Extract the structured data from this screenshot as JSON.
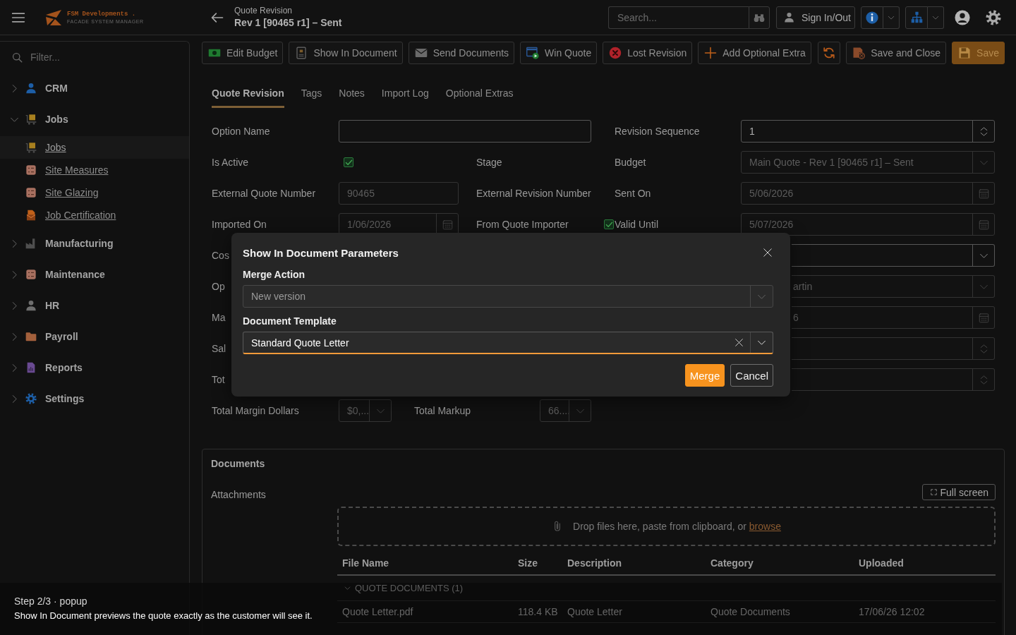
{
  "app_bar": {
    "brand": "FSM Developments .",
    "tagline": "FACADE SYSTEM MANAGER",
    "page_kicker": "Quote Revision",
    "page_title": "Rev 1 [90465 r1] – Sent",
    "search": {
      "placeholder": "Search..."
    },
    "sign_in_button": "Sign In/Out"
  },
  "sidebar": {
    "filter": {
      "placeholder": "Filter..."
    },
    "items": [
      {
        "label": "CRM",
        "expanded": false
      },
      {
        "label": "Jobs",
        "expanded": true,
        "children": [
          {
            "label": "Jobs",
            "selected": true
          },
          {
            "label": "Site Measures",
            "selected": false
          },
          {
            "label": "Site Glazing",
            "selected": false
          },
          {
            "label": "Job Certification",
            "selected": false
          }
        ]
      },
      {
        "label": "Manufacturing",
        "expanded": false
      },
      {
        "label": "Maintenance",
        "expanded": false
      },
      {
        "label": "HR",
        "expanded": false
      },
      {
        "label": "Payroll",
        "expanded": false
      },
      {
        "label": "Reports",
        "expanded": false
      },
      {
        "label": "Settings",
        "expanded": false
      }
    ]
  },
  "toolbar": {
    "buttons": [
      {
        "label": "Edit Budget"
      },
      {
        "label": "Show In Document"
      },
      {
        "label": "Send Documents"
      },
      {
        "label": "Win Quote"
      },
      {
        "label": "Lost Revision"
      },
      {
        "label": "Add Optional Extra"
      }
    ],
    "actions": [
      {
        "label": "Save and Close",
        "kind": "secondary",
        "disabled": false
      },
      {
        "label": "Save",
        "kind": "primary",
        "disabled": true
      }
    ]
  },
  "tabs": [
    {
      "label": "Quote Revision",
      "selected": true
    },
    {
      "label": "Tags",
      "selected": false
    },
    {
      "label": "Notes",
      "selected": false
    },
    {
      "label": "Import Log",
      "selected": false
    },
    {
      "label": "Optional Extras",
      "selected": false
    }
  ],
  "form": {
    "rows": [
      {
        "kind": "wide",
        "label": "Option Name",
        "field": {
          "kind": "input",
          "disabled": false
        },
        "right": {
          "label": "Revision Sequence",
          "field": {
            "kind": "spinner",
            "value": "1",
            "disabled": false
          }
        }
      },
      {
        "kind": "pair",
        "label": "Is Active",
        "field": {
          "kind": "checkbox",
          "checked": true
        },
        "middle_label": "Stage",
        "right": {
          "label": "Budget",
          "field": {
            "kind": "select",
            "value": "Main Quote - Rev 1 [90465 r1] – Sent",
            "disabled": true
          }
        }
      },
      {
        "kind": "pair",
        "label": "External Quote Number",
        "field": {
          "kind": "input",
          "value": "90465",
          "disabled": true
        },
        "middle_label": "External Revision Number",
        "right": {
          "label": "Sent On",
          "field": {
            "kind": "date",
            "value": "5/06/2026",
            "disabled": true
          }
        }
      },
      {
        "kind": "pair",
        "label": "Imported On",
        "field": {
          "kind": "date",
          "value": "1/06/2026",
          "disabled": true
        },
        "middle_label": "From Quote Importer",
        "right": {
          "checkbox": {
            "checked": true
          },
          "label": "Valid Until",
          "field": {
            "kind": "date",
            "value": "5/07/2026",
            "disabled": true
          }
        }
      },
      {
        "kind": "partial",
        "label": "Cos",
        "right": {
          "field": {
            "kind": "select",
            "disabled": false
          }
        }
      },
      {
        "kind": "partial",
        "label": "Op",
        "right": {
          "field": {
            "kind": "select",
            "value": "artin",
            "disabled": true
          }
        }
      },
      {
        "kind": "partial",
        "label": "Ma",
        "right": {
          "field": {
            "kind": "date",
            "value": "6",
            "disabled": true
          }
        }
      },
      {
        "kind": "partial",
        "label": "Sal",
        "right": {
          "field": {
            "kind": "spinner",
            "disabled": true
          }
        }
      },
      {
        "kind": "partial",
        "label": "Tot",
        "right": {
          "field": {
            "kind": "spinner",
            "disabled": true
          }
        }
      },
      {
        "kind": "totals",
        "label": "Total Margin Dollars",
        "field": {
          "kind": "select",
          "value": "$0,...",
          "disabled": true
        },
        "middle_label": "Total Markup",
        "middle_field": {
          "kind": "select",
          "value": "66....",
          "disabled": true
        }
      }
    ]
  },
  "documents": {
    "title": "Documents",
    "attachments_label": "Attachments",
    "full_screen_button": "Full screen",
    "dropzone": {
      "text": "Drop files here, paste from clipboard, or",
      "link": "browse"
    },
    "table": {
      "columns": [
        "File Name",
        "Size",
        "Description",
        "Category",
        "Uploaded"
      ],
      "groups": [
        {
          "label": "QUOTE DOCUMENTS (1)",
          "rows": [
            {
              "cells": [
                "Quote Letter.pdf",
                "118.4 KB",
                "Quote Letter",
                "Quote Documents",
                "17/06/26 12:02"
              ]
            }
          ]
        }
      ]
    }
  },
  "dialog": {
    "title": "Show In Document Parameters",
    "fields": [
      {
        "label": "Merge Action",
        "value": "New version",
        "disabled": true,
        "clearable": false,
        "focused": false
      },
      {
        "label": "Document Template",
        "value": "Standard Quote Letter",
        "disabled": false,
        "clearable": true,
        "focused": true
      }
    ],
    "buttons": [
      {
        "label": "Merge",
        "kind": "primary"
      },
      {
        "label": "Cancel",
        "kind": "secondary"
      }
    ]
  },
  "caption": {
    "step": "Step 2/3 · popup",
    "text": "Show In Document previews the quote exactly as the customer will see it."
  }
}
